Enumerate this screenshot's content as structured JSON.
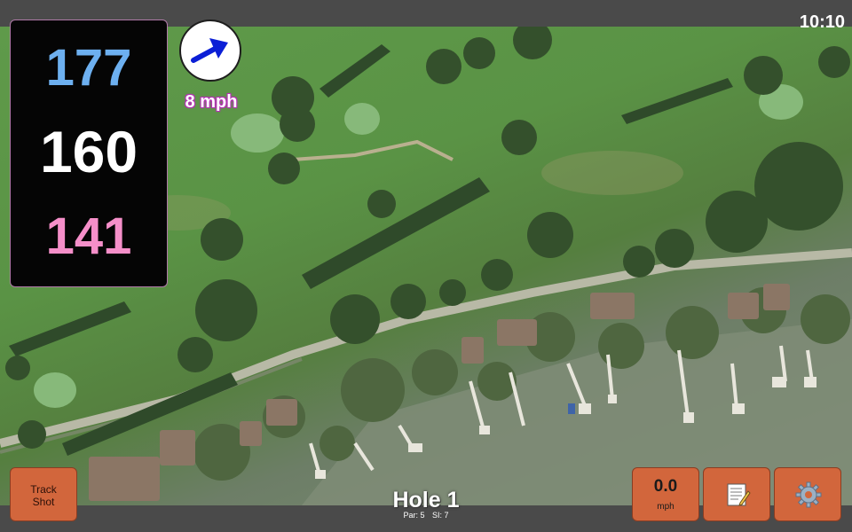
{
  "status_bar": {
    "time": "10:10"
  },
  "distances": {
    "back": "177",
    "middle": "160",
    "front": "141",
    "back_color": "#6db0f0",
    "middle_color": "#ffffff",
    "front_color": "#f58fc9"
  },
  "wind": {
    "speed": "8 mph",
    "direction_icon": "arrow-icon",
    "arrow_color": "#0b1fd6"
  },
  "map": {
    "type": "satellite",
    "content": "golf course hole aerial view"
  },
  "buttons": {
    "track_shot": "Track\nShot",
    "speed_value": "0.0",
    "speed_unit": "mph",
    "notes_icon": "notepad-icon",
    "settings_icon": "gear-icon",
    "accent_color": "#d2663c"
  },
  "hole": {
    "title": "Hole 1",
    "par": "Par: 5",
    "si": "SI: 7"
  }
}
